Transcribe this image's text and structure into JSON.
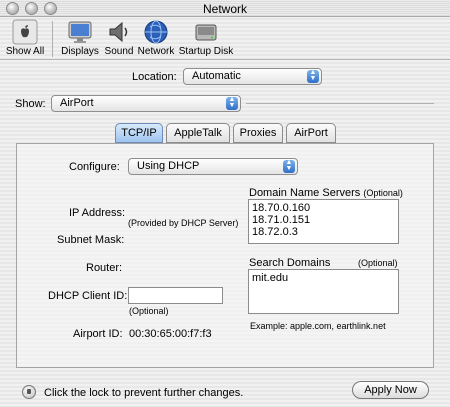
{
  "window": {
    "title": "Network"
  },
  "toolbar": {
    "items": [
      {
        "label": "Show All",
        "icon": "apple-logo-icon"
      },
      {
        "label": "Displays",
        "icon": "display-icon"
      },
      {
        "label": "Sound",
        "icon": "speaker-icon"
      },
      {
        "label": "Network",
        "icon": "globe-icon"
      },
      {
        "label": "Startup Disk",
        "icon": "hard-disk-icon"
      }
    ]
  },
  "location": {
    "label": "Location:",
    "value": "Automatic"
  },
  "show": {
    "label": "Show:",
    "value": "AirPort"
  },
  "tabs": [
    {
      "label": "TCP/IP",
      "active": true
    },
    {
      "label": "AppleTalk",
      "active": false
    },
    {
      "label": "Proxies",
      "active": false
    },
    {
      "label": "AirPort",
      "active": false
    }
  ],
  "tcpip": {
    "configure_label": "Configure:",
    "configure_value": "Using DHCP",
    "ip_label": "IP Address:",
    "ip_value": "(Provided by DHCP Server)",
    "subnet_label": "Subnet Mask:",
    "router_label": "Router:",
    "dhcp_client_label": "DHCP Client ID:",
    "dhcp_client_value": "",
    "dhcp_optional": "(Optional)",
    "airport_id_label": "Airport ID:",
    "airport_id_value": "00:30:65:00:f7:f3",
    "dns_label": "Domain Name Servers",
    "dns_optional": "(Optional)",
    "dns_servers": [
      "18.70.0.160",
      "18.71.0.151",
      "18.72.0.3"
    ],
    "search_label": "Search Domains",
    "search_optional": "(Optional)",
    "search_domains": [
      "mit.edu"
    ],
    "example": "Example: apple.com, earthlink.net"
  },
  "footer": {
    "lock_text": "Click the lock to prevent further changes.",
    "apply_label": "Apply Now"
  }
}
